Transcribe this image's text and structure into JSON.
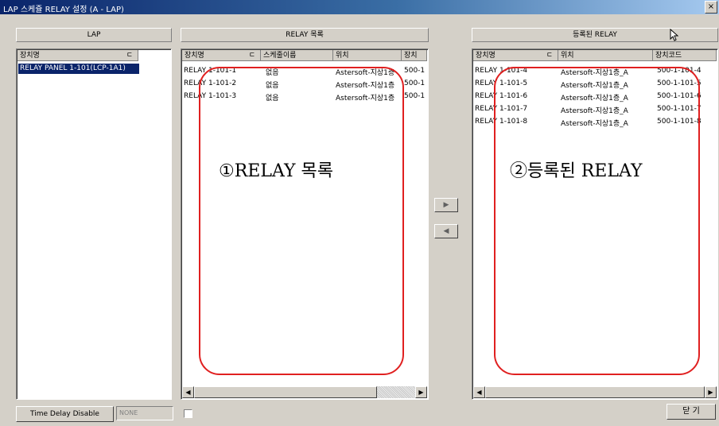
{
  "window": {
    "title": "LAP 스케쥴 RELAY 설정 (A - LAP)",
    "close": "×"
  },
  "lap": {
    "header": "LAP",
    "col_name": "장치명",
    "sort_icon": "ㄷ",
    "rows": [
      "RELAY PANEL 1-101(LCP-1A1)"
    ]
  },
  "relay_list": {
    "header": "RELAY 목록",
    "cols": [
      "장치명",
      "스케줄이름",
      "위치",
      "장치"
    ],
    "sort_icon": "ㄷ",
    "rows": [
      [
        "RELAY 1-101-1",
        "없음",
        "Astersoft-지상1층",
        "500-1"
      ],
      [
        "RELAY 1-101-2",
        "없음",
        "Astersoft-지상1층",
        "500-1"
      ],
      [
        "RELAY 1-101-3",
        "없음",
        "Astersoft-지상1층",
        "500-1"
      ]
    ],
    "annotation": "①RELAY 목록"
  },
  "registered": {
    "header": "등록된 RELAY",
    "cols": [
      "장치명",
      "위치",
      "장치코드"
    ],
    "sort_icon": "ㄷ",
    "rows": [
      [
        "RELAY 1-101-4",
        "Astersoft-지상1층_A",
        "500-1-101-4"
      ],
      [
        "RELAY 1-101-5",
        "Astersoft-지상1층_A",
        "500-1-101-5"
      ],
      [
        "RELAY 1-101-6",
        "Astersoft-지상1층_A",
        "500-1-101-6"
      ],
      [
        "RELAY 1-101-7",
        "Astersoft-지상1층_A",
        "500-1-101-7"
      ],
      [
        "RELAY 1-101-8",
        "Astersoft-지상1층_A",
        "500-1-101-8"
      ]
    ],
    "annotation": "②등록된 RELAY"
  },
  "buttons": {
    "move_right": "▶",
    "move_left": "◀",
    "close": "닫 기",
    "scroll_left": "◀",
    "scroll_right": "▶"
  },
  "footer": {
    "time_delay_label": "Time Delay Disable",
    "time_delay_value": "NONE"
  },
  "colors": {
    "title_start": "#0a246a",
    "selection": "#0a246a",
    "annotation_box": "#e02020"
  }
}
